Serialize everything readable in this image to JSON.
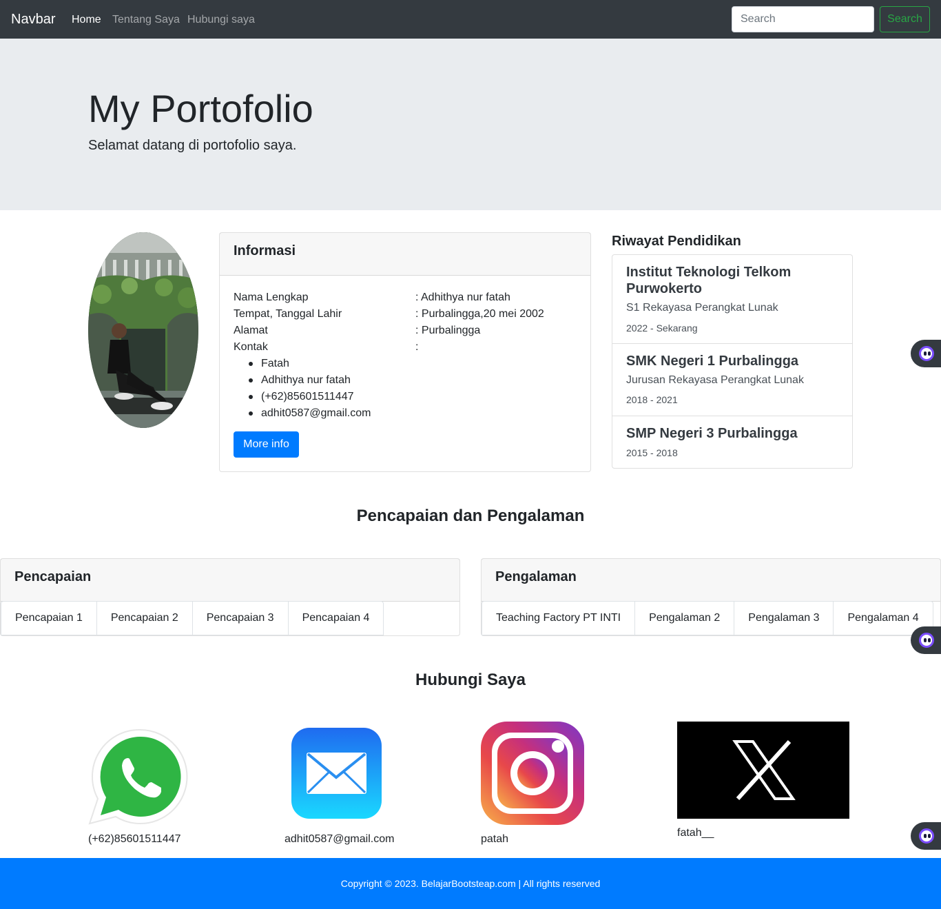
{
  "navbar": {
    "brand": "Navbar",
    "links": [
      {
        "label": "Home",
        "active": true
      },
      {
        "label": "Tentang Saya",
        "active": false
      },
      {
        "label": "Hubungi saya",
        "active": false
      }
    ],
    "search_placeholder": "Search",
    "search_button": "Search"
  },
  "hero": {
    "title": "My Portofolio",
    "subtitle": "Selamat datang di portofolio saya."
  },
  "info": {
    "header": "Informasi",
    "rows": [
      {
        "label": "Nama Lengkap",
        "value": ": Adhithya nur fatah"
      },
      {
        "label": "Tempat, Tanggal Lahir",
        "value": ": Purbalingga,20 mei 2002"
      },
      {
        "label": "Alamat",
        "value": ": Purbalingga"
      },
      {
        "label": "Kontak",
        "value": ":"
      }
    ],
    "contacts": [
      "Fatah",
      "Adhithya nur fatah",
      "(+62)85601511447",
      "adhit0587@gmail.com"
    ],
    "more_button": "More info"
  },
  "education": {
    "title": "Riwayat Pendidikan",
    "items": [
      {
        "school": "Institut Teknologi Telkom Purwokerto",
        "major": "S1 Rekayasa Perangkat Lunak",
        "years": "2022 - Sekarang"
      },
      {
        "school": "SMK Negeri 1 Purbalingga",
        "major": "Jurusan Rekayasa Perangkat Lunak",
        "years": "2018 - 2021"
      },
      {
        "school": "SMP Negeri 3 Purbalingga",
        "major": "",
        "years": "2015 - 2018"
      }
    ]
  },
  "achievements_section": {
    "title": "Pencapaian dan Pengalaman",
    "pencapaian": {
      "header": "Pencapaian",
      "tabs": [
        "Pencapaian 1",
        "Pencapaian 2",
        "Pencapaian 3",
        "Pencapaian 4"
      ]
    },
    "pengalaman": {
      "header": "Pengalaman",
      "tabs": [
        "Teaching Factory PT INTI",
        "Pengalaman 2",
        "Pengalaman 3",
        "Pengalaman 4"
      ]
    }
  },
  "contact": {
    "title": "Hubungi Saya",
    "items": [
      {
        "icon": "whatsapp-icon",
        "label": "(+62)85601511447"
      },
      {
        "icon": "mail-icon",
        "label": "adhit0587@gmail.com"
      },
      {
        "icon": "instagram-icon",
        "label": "patah"
      },
      {
        "icon": "x-icon",
        "label": "fatah__"
      }
    ]
  },
  "footer": {
    "text": "Copyright © 2023. BelajarBootsteap.com | All rights reserved"
  },
  "colors": {
    "navbar_bg": "#343a40",
    "jumbotron_bg": "#e9ecef",
    "primary": "#007bff",
    "success": "#28a745",
    "footer_bg": "#007bff"
  }
}
